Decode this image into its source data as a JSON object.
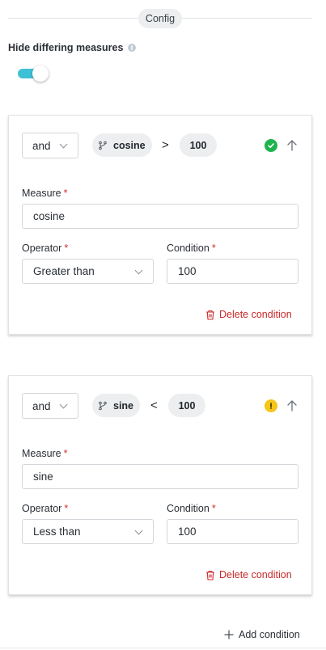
{
  "header": {
    "config_label": "Config"
  },
  "settings": {
    "hide_differing_label": "Hide differing measures",
    "hide_differing_enabled": true
  },
  "conditions": [
    {
      "logic": "and",
      "measure_chip": "cosine",
      "operator_symbol": ">",
      "value_chip": "100",
      "status": "valid",
      "status_icon": "check-circle-icon",
      "measure_label": "Measure",
      "measure_value": "cosine",
      "operator_label": "Operator",
      "operator_value": "Greater than",
      "condition_label": "Condition",
      "condition_value": "100",
      "required_mark": "*",
      "delete_label": "Delete condition"
    },
    {
      "logic": "and",
      "measure_chip": "sine",
      "operator_symbol": "<",
      "value_chip": "100",
      "status": "warning",
      "status_icon": "warning-circle-icon",
      "measure_label": "Measure",
      "measure_value": "sine",
      "operator_label": "Operator",
      "operator_value": "Less than",
      "condition_label": "Condition",
      "condition_value": "100",
      "required_mark": "*",
      "delete_label": "Delete condition"
    }
  ],
  "actions": {
    "add_condition_label": "Add condition"
  },
  "colors": {
    "toggle_on": "#3ec0d6",
    "valid": "#1fb34f",
    "warning": "#f5c518",
    "danger": "#c82828",
    "required": "#d0312d"
  }
}
